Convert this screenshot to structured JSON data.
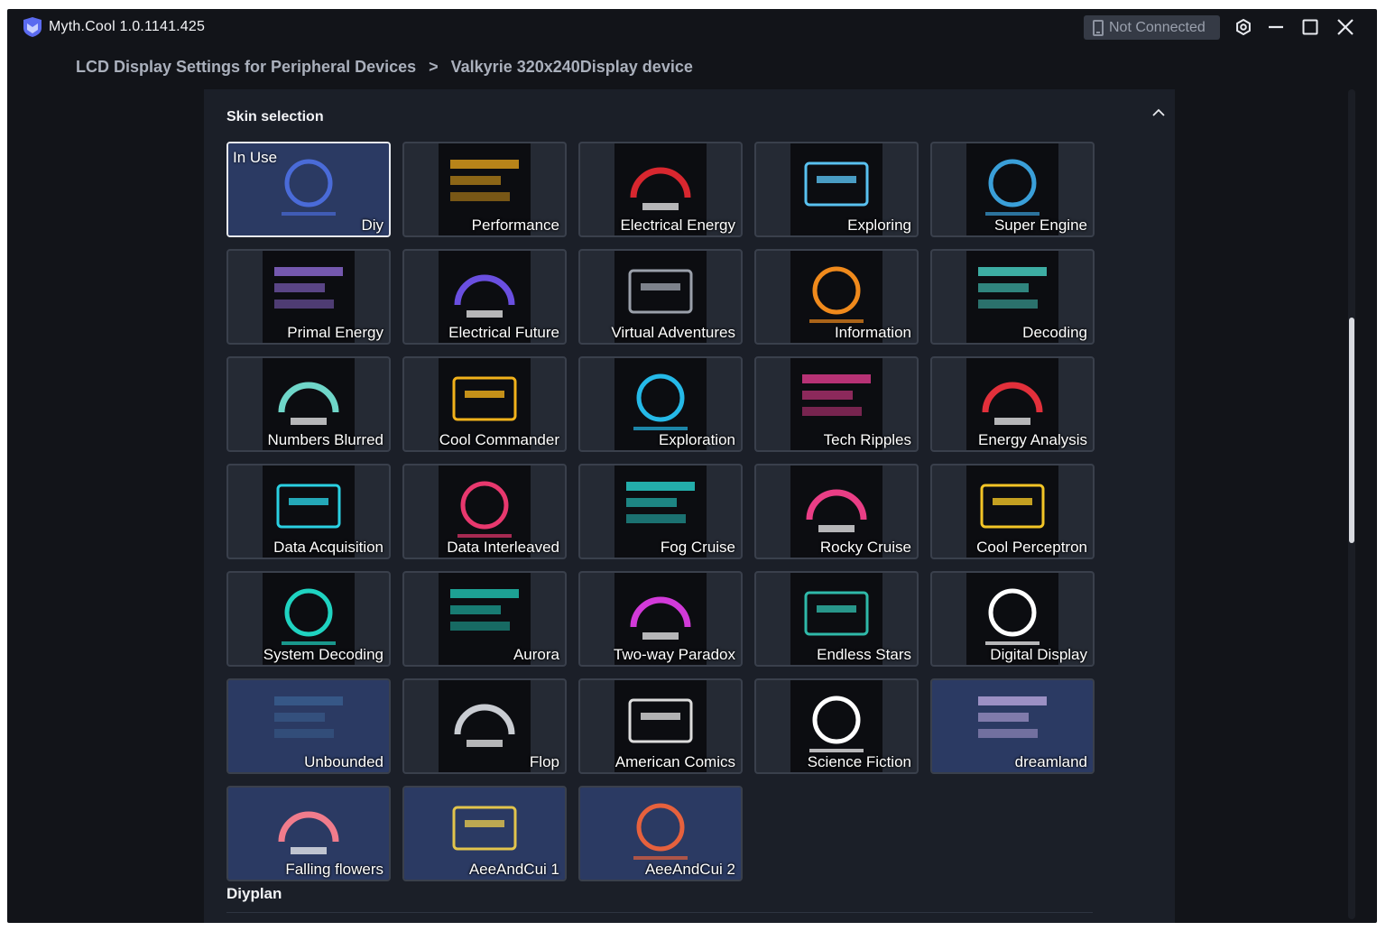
{
  "app": {
    "title": "Myth.Cool 1.0.1141.425"
  },
  "connection": {
    "status": "Not Connected"
  },
  "window_controls": [
    "settings-icon",
    "minimize-icon",
    "maximize-icon",
    "close-icon"
  ],
  "breadcrumb": {
    "parent": "LCD Display Settings for Peripheral Devices",
    "separator": ">",
    "current": "Valkyrie 320x240Display device"
  },
  "skin_section": {
    "title": "Skin selection",
    "in_use_label": "In Use",
    "selected": "Diy",
    "skins": [
      {
        "label": "Diy",
        "icon": "diy-skin-preview",
        "accent": "#4a6bd8"
      },
      {
        "label": "Performance",
        "icon": "gauge-preview",
        "accent": "#e3a21c"
      },
      {
        "label": "Electrical Energy",
        "icon": "red-dial-preview",
        "accent": "#d8272f"
      },
      {
        "label": "Exploring",
        "icon": "striped-gauge-preview",
        "accent": "#59c1f0"
      },
      {
        "label": "Super Engine",
        "icon": "engine-preview",
        "accent": "#3a9fd9"
      },
      {
        "label": "Primal Energy",
        "icon": "bars-preview",
        "accent": "#8f6bd6"
      },
      {
        "label": "Electrical Future",
        "icon": "grid-preview",
        "accent": "#6a4fe0"
      },
      {
        "label": "Virtual Adventures",
        "icon": "temp-box-preview",
        "accent": "#9aa0aa"
      },
      {
        "label": "Information",
        "icon": "info-panel-preview",
        "accent": "#f08a1c"
      },
      {
        "label": "Decoding",
        "icon": "ring-preview",
        "accent": "#4ad6c8"
      },
      {
        "label": "Numbers Blurred",
        "icon": "blur-numbers-preview",
        "accent": "#6fd6c9"
      },
      {
        "label": "Cool Commander",
        "icon": "mascot-ring-preview",
        "accent": "#f2b21b"
      },
      {
        "label": "Exploration",
        "icon": "arc-preview",
        "accent": "#25b9e8"
      },
      {
        "label": "Tech Ripples",
        "icon": "ripple-preview",
        "accent": "#e23c8e"
      },
      {
        "label": "Energy Analysis",
        "icon": "red-ring-preview",
        "accent": "#e2303b"
      },
      {
        "label": "Data Acquisition",
        "icon": "cyan-text-preview",
        "accent": "#2ad0e2"
      },
      {
        "label": "Data Interleaved",
        "icon": "slash-preview",
        "accent": "#e8386e"
      },
      {
        "label": "Fog Cruise",
        "icon": "fog-character-preview",
        "accent": "#29d6d1"
      },
      {
        "label": "Rocky Cruise",
        "icon": "rocky-character-preview",
        "accent": "#ea3e86"
      },
      {
        "label": "Cool Perceptron",
        "icon": "yellow-mascot-preview",
        "accent": "#f3c526"
      },
      {
        "label": "System Decoding",
        "icon": "teal-frame-preview",
        "accent": "#1fd3c1"
      },
      {
        "label": "Aurora",
        "icon": "teal-dial-preview",
        "accent": "#22c7b5"
      },
      {
        "label": "Two-way Paradox",
        "icon": "clock-ring-preview",
        "accent": "#d23ad9"
      },
      {
        "label": "Endless Stars",
        "icon": "star-clock-preview",
        "accent": "#2fb9a9"
      },
      {
        "label": "Digital Display",
        "icon": "digital-text-preview",
        "accent": "#ffffff"
      },
      {
        "label": "Unbounded",
        "icon": "nebula-preview",
        "accent": "#3a5f8f"
      },
      {
        "label": "Flop",
        "icon": "flip-clock-preview",
        "accent": "#c9ccd2"
      },
      {
        "label": "American Comics",
        "icon": "comic-preview",
        "accent": "#dcdcdc"
      },
      {
        "label": "Science Fiction",
        "icon": "cpu-text-preview",
        "accent": "#ffffff"
      },
      {
        "label": "dreamland",
        "icon": "dreamland-preview",
        "accent": "#b9a6dc"
      },
      {
        "label": "Falling flowers",
        "icon": "flowers-preview",
        "accent": "#f07c8c"
      },
      {
        "label": "AeeAndCui 1",
        "icon": "painter-scene-1-preview",
        "accent": "#e2c44c"
      },
      {
        "label": "AeeAndCui 2",
        "icon": "painter-scene-2-preview",
        "accent": "#e6613d"
      }
    ]
  },
  "diyplan_section": {
    "title": "Diyplan"
  }
}
